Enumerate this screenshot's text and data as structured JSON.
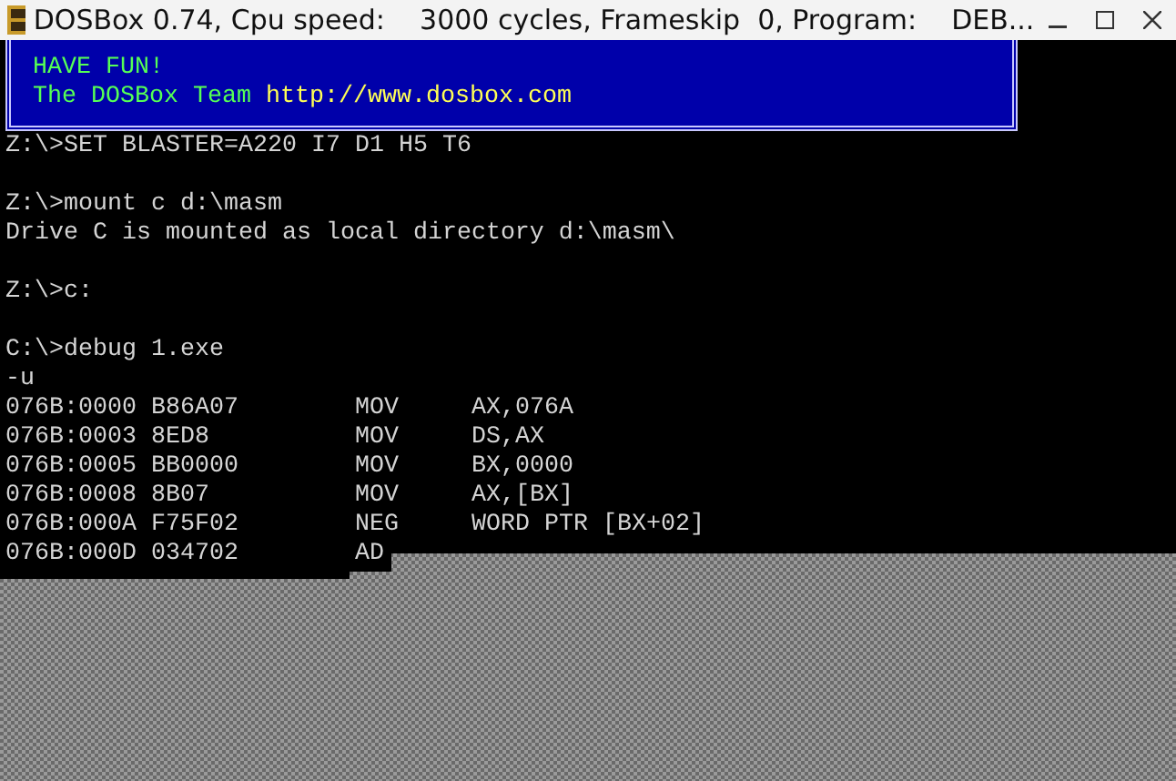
{
  "window": {
    "title": "DOSBox 0.74, Cpu speed:    3000 cycles, Frameskip  0, Program:    DEB..."
  },
  "banner": {
    "lines": [
      {
        "text": "HAVE FUN!",
        "kind": "plain"
      },
      {
        "text": "The DOSBox Team",
        "kind": "plain",
        "link": "http://www.dosbox.com"
      }
    ]
  },
  "console": [
    {
      "kind": "line",
      "text": "Z:\\>SET BLASTER=A220 I7 D1 H5 T6"
    },
    {
      "kind": "blank"
    },
    {
      "kind": "line",
      "text": "Z:\\>mount c d:\\masm"
    },
    {
      "kind": "line",
      "text": "Drive C is mounted as local directory d:\\masm\\"
    },
    {
      "kind": "blank"
    },
    {
      "kind": "line",
      "text": "Z:\\>c:"
    },
    {
      "kind": "blank"
    },
    {
      "kind": "line",
      "text": "C:\\>debug 1.exe"
    },
    {
      "kind": "line",
      "text": "-u"
    }
  ],
  "disassembly": [
    {
      "address": "076B:0000",
      "bytes": "B86A07",
      "mnemonic": "MOV",
      "operands": "AX,076A"
    },
    {
      "address": "076B:0003",
      "bytes": "8ED8",
      "mnemonic": "MOV",
      "operands": "DS,AX"
    },
    {
      "address": "076B:0005",
      "bytes": "BB0000",
      "mnemonic": "MOV",
      "operands": "BX,0000"
    },
    {
      "address": "076B:0008",
      "bytes": "8B07",
      "mnemonic": "MOV",
      "operands": "AX,[BX]"
    },
    {
      "address": "076B:000A",
      "bytes": "F75F02",
      "mnemonic": "NEG",
      "operands": "WORD PTR [BX+02]"
    },
    {
      "address": "076B:000D",
      "bytes": "034702",
      "mnemonic": "AD"
    }
  ]
}
